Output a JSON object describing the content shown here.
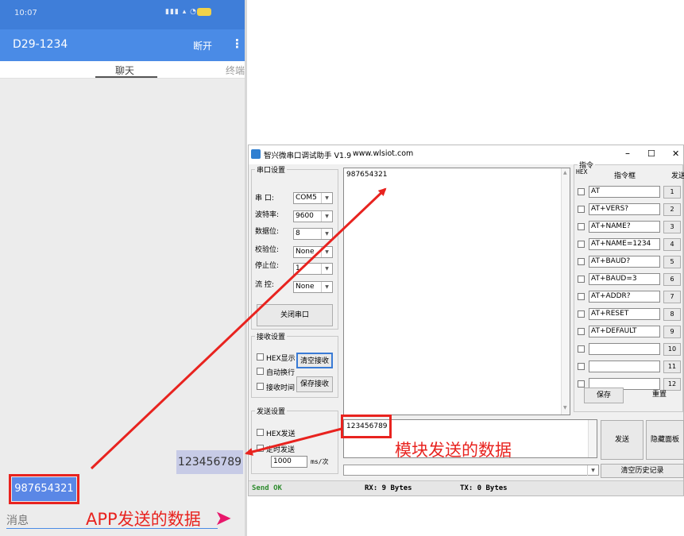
{
  "phone": {
    "time": "10:07",
    "device_name": "D29-1234",
    "disconnect_label": "断开",
    "menu_icon": "more-vert-icon",
    "tabs": [
      "聊天",
      "终端"
    ],
    "received_message": "123456789",
    "sent_message": "987654321",
    "input_placeholder": "消息",
    "send_icon": "send-arrow-icon"
  },
  "serial": {
    "title": "智兴微串口调试助手 V1.9",
    "website": "www.wlsiot.com",
    "window_controls": [
      "–",
      "☐",
      "✕"
    ],
    "port_settings": {
      "legend": "串口设置",
      "port_label": "串  口:",
      "port_value": "COM5",
      "baud_label": "波特率:",
      "baud_value": "9600",
      "databits_label": "数据位:",
      "databits_value": "8",
      "parity_label": "校验位:",
      "parity_value": "None",
      "stopbits_label": "停止位:",
      "stopbits_value": "1",
      "flow_label": "流  控:",
      "flow_value": "None",
      "close_port": "关闭串口"
    },
    "receive_settings": {
      "legend": "接收设置",
      "hex_display": "HEX显示",
      "auto_wrap": "自动换行",
      "recv_time": "接收时间",
      "clear_recv": "清空接收",
      "save_recv": "保存接收"
    },
    "send_settings": {
      "legend": "发送设置",
      "hex_send": "HEX发送",
      "timed_send": "定时发送",
      "interval_value": "1000",
      "interval_unit": "ms/次"
    },
    "receive_text": "987654321",
    "send_text": "123456789",
    "send_button": "发送",
    "hide_panel": "隐藏面板",
    "clear_history": "清空历史记录",
    "commands": {
      "legend": "指令",
      "hex_header": "HEX",
      "box_header": "指令框",
      "send_header": "发送",
      "items": [
        {
          "text": "AT",
          "num": "1"
        },
        {
          "text": "AT+VERS?",
          "num": "2"
        },
        {
          "text": "AT+NAME?",
          "num": "3"
        },
        {
          "text": "AT+NAME=1234",
          "num": "4"
        },
        {
          "text": "AT+BAUD?",
          "num": "5"
        },
        {
          "text": "AT+BAUD=3",
          "num": "6"
        },
        {
          "text": "AT+ADDR?",
          "num": "7"
        },
        {
          "text": "AT+RESET",
          "num": "8"
        },
        {
          "text": "AT+DEFAULT",
          "num": "9"
        },
        {
          "text": "",
          "num": "10"
        },
        {
          "text": "",
          "num": "11"
        },
        {
          "text": "",
          "num": "12"
        }
      ],
      "save": "保存",
      "reset": "重置"
    },
    "status": {
      "send_ok": "Send OK",
      "rx": "RX: 9 Bytes",
      "tx": "TX: 0 Bytes"
    }
  },
  "annotations": {
    "module_sent": "模块发送的数据",
    "app_sent": "APP发送的数据",
    "highlight_color": "#e8231f"
  }
}
